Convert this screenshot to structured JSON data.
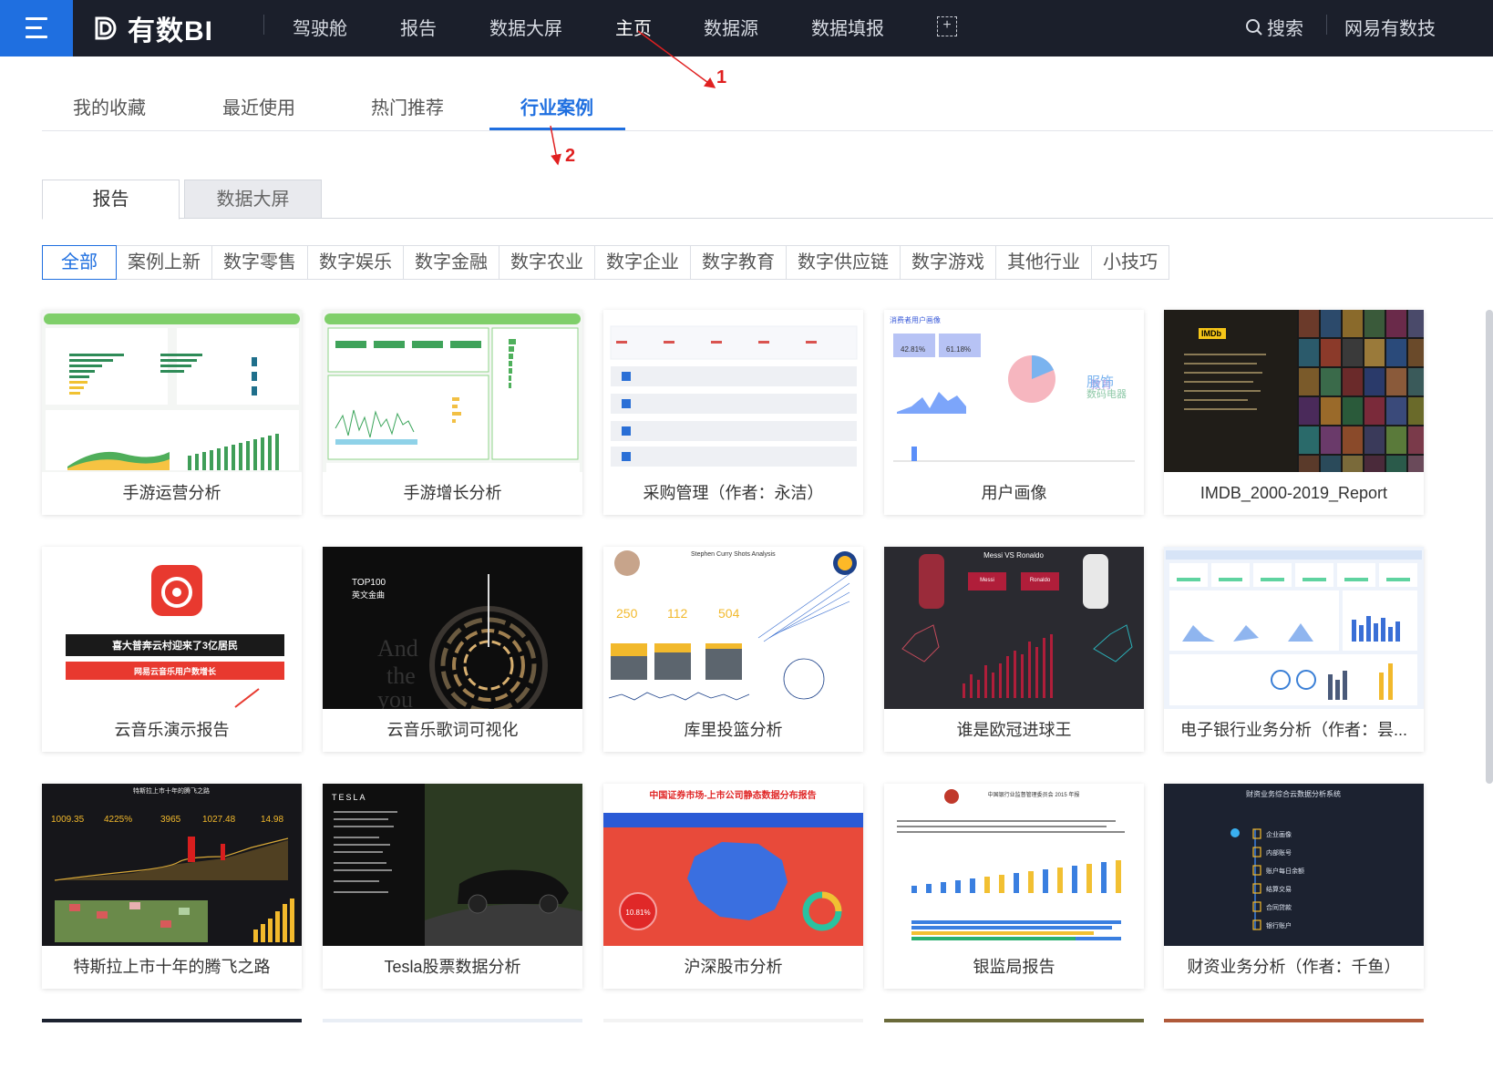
{
  "nav": {
    "logo_text": "有数BI",
    "items": [
      "驾驶舱",
      "报告",
      "数据大屏",
      "主页",
      "数据源",
      "数据填报"
    ],
    "add_symbol": "+",
    "search_label": "搜索",
    "org_label": "网易有数技"
  },
  "tabs": [
    "我的收藏",
    "最近使用",
    "热门推荐",
    "行业案例"
  ],
  "active_tab": "行业案例",
  "annotations": [
    "1",
    "2"
  ],
  "subtabs": [
    "报告",
    "数据大屏"
  ],
  "filters": [
    "全部",
    "案例上新",
    "数字零售",
    "数字娱乐",
    "数字金融",
    "数字农业",
    "数字企业",
    "数字教育",
    "数字供应链",
    "数字游戏",
    "其他行业",
    "小技巧"
  ],
  "cards": [
    {
      "title": "手游运营分析",
      "thumb": "game-ops"
    },
    {
      "title": "手游增长分析",
      "thumb": "game-growth"
    },
    {
      "title": "采购管理（作者：永洁）",
      "thumb": "procurement"
    },
    {
      "title": "用户画像",
      "thumb": "user-profile"
    },
    {
      "title": "IMDB_2000-2019_Report",
      "thumb": "imdb"
    },
    {
      "title": "云音乐演示报告",
      "thumb": "cloud-music"
    },
    {
      "title": "云音乐歌词可视化",
      "thumb": "lyrics"
    },
    {
      "title": "库里投篮分析",
      "thumb": "curry"
    },
    {
      "title": "谁是欧冠进球王",
      "thumb": "messi-ronaldo"
    },
    {
      "title": "电子银行业务分析（作者：昙...",
      "thumb": "ebank"
    },
    {
      "title": "特斯拉上市十年的腾飞之路",
      "thumb": "tesla-decade"
    },
    {
      "title": "Tesla股票数据分析",
      "thumb": "tesla-stock"
    },
    {
      "title": "沪深股市分析",
      "thumb": "stock-map"
    },
    {
      "title": "银监局报告",
      "thumb": "cbrc"
    },
    {
      "title": "财资业务分析（作者：千鱼）",
      "thumb": "treasury"
    }
  ],
  "thumb_text": {
    "imdb_badge": "IMDb",
    "music_banner1": "喜大普奔云村迎来了3亿居民",
    "music_banner2": "网易云音乐用户数增长",
    "lyrics_top": "TOP100",
    "lyrics_sub": "英文金曲",
    "curry_title": "Stephen Curry Shots Analysis",
    "curry_nums": [
      "250",
      "112",
      "504"
    ],
    "mr_title": "Messi VS Ronaldo",
    "mr_left": "Messi",
    "mr_right": "Ronaldo",
    "tesla_title": "特斯拉上市十年的腾飞之路",
    "tesla_nums": [
      "1009.35",
      "4225%",
      "3965",
      "1027.48",
      "14.98"
    ],
    "tesla_logo": "TESLA",
    "stock_title": "中国证券市场-上市公司静态数据分布报告",
    "stock_pct": "10.81%",
    "cbrc_title": "中国银行业监督管理委员会 2015 年报",
    "treasury_title": "财资业务综合云数据分析系统",
    "treasury_items": [
      "企业画像",
      "内部账号",
      "账户每日余额",
      "结算交易",
      "合同贷款",
      "银行账户"
    ],
    "user_title": "消费者用户画像",
    "user_pcts": [
      "42.81%",
      "61.18%"
    ],
    "user_words": [
      "教育",
      "服饰",
      "数码电器"
    ]
  },
  "colors": {
    "nav_bg": "#1b1f2b",
    "brand_blue": "#1f6fe0",
    "annotation_red": "#e02020"
  }
}
